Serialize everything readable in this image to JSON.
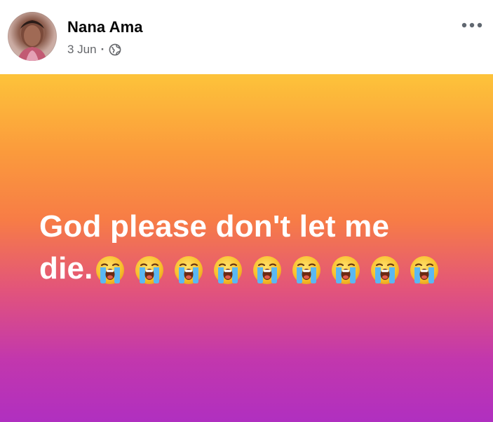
{
  "author": {
    "name": "Nana Ama",
    "date": "3 Jun",
    "separator": "·",
    "audience_icon": "globe-icon",
    "avatar": "profile-photo"
  },
  "post": {
    "text_line1": "God please don't let me",
    "text_line2": "die.",
    "emoji": "loudly-crying-face",
    "emoji_count": 9,
    "background_colors": [
      "#fdc33a",
      "#f77c46",
      "#e2547b",
      "#b02fc0"
    ],
    "text_color": "#ffffff"
  },
  "menu": {
    "icon": "more-options-icon"
  }
}
